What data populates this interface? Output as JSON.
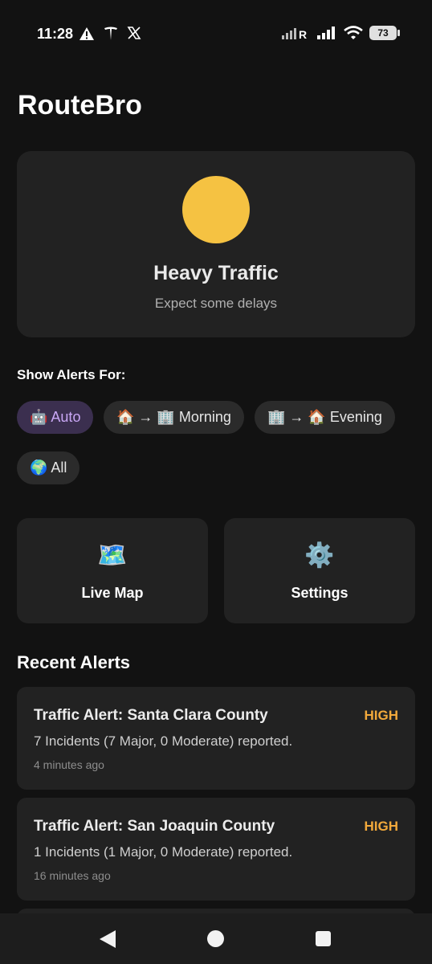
{
  "status_bar": {
    "time": "11:28",
    "left_icons": [
      "warning-icon",
      "tesla-icon",
      "x-icon"
    ],
    "right_icons": [
      "signal-r-icon",
      "signal-icon",
      "wifi-icon",
      "battery-icon"
    ],
    "battery": "73"
  },
  "app": {
    "title": "RouteBro"
  },
  "status_card": {
    "indicator_color": "#F5C242",
    "title": "Heavy Traffic",
    "subtitle": "Expect some delays"
  },
  "alerts_for": {
    "label": "Show Alerts For:",
    "chips": [
      {
        "label": "🤖 Auto",
        "active": true
      },
      {
        "label": "🏠 → 🏢 Morning",
        "active": false
      },
      {
        "label": "🏢 → 🏠 Evening",
        "active": false
      },
      {
        "label": "🌍 All",
        "active": false
      }
    ]
  },
  "actions": [
    {
      "icon": "🗺️",
      "icon_name": "map-icon",
      "label": "Live Map"
    },
    {
      "icon": "⚙️",
      "icon_name": "gear-icon",
      "label": "Settings"
    }
  ],
  "recent": {
    "title": "Recent Alerts",
    "level_color": "#F2A93B",
    "items": [
      {
        "title": "Traffic Alert: Santa Clara County",
        "level": "HIGH",
        "description": "7 Incidents (7 Major, 0 Moderate) reported.",
        "time": "4 minutes ago"
      },
      {
        "title": "Traffic Alert: San Joaquin County",
        "level": "HIGH",
        "description": "1 Incidents (1 Major, 0 Moderate) reported.",
        "time": "16 minutes ago"
      }
    ]
  },
  "nav": {
    "icons": [
      "back-icon",
      "home-icon",
      "recents-icon"
    ]
  }
}
